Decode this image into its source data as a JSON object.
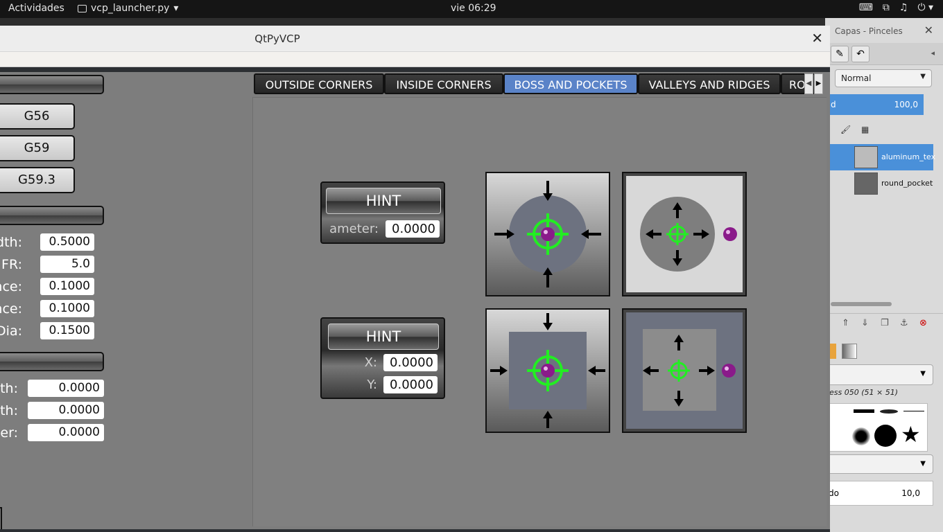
{
  "topbar": {
    "activities": "Actividades",
    "app_name": "vcp_launcher.py",
    "clock": "vie 06:29"
  },
  "gimp": {
    "dock_title": "Capas - Pinceles",
    "mode": "Normal",
    "opacity_value": "100,0",
    "layers": [
      "aluminum_tex",
      "round_pocket"
    ],
    "brush_name": "ess 050 (51 × 51)",
    "spacing_label": "do",
    "spacing_value": "10,0"
  },
  "window": {
    "title": "QtPyVCP"
  },
  "left": {
    "g_buttons": [
      "G56",
      "G59",
      "G59.3"
    ],
    "fields_a": [
      {
        "label": "dth:",
        "value": "0.5000"
      },
      {
        "label": "FR:",
        "value": "5.0"
      },
      {
        "label": "nce:",
        "value": "0.1000"
      },
      {
        "label": "nce:",
        "value": "0.1000"
      },
      {
        "label": "Dia:",
        "value": "0.1500"
      }
    ],
    "fields_b": [
      {
        "label": "th:",
        "value": "0.0000"
      },
      {
        "label": "th:",
        "value": "0.0000"
      },
      {
        "label": "er:",
        "value": "0.0000"
      }
    ]
  },
  "tabs": [
    "OUTSIDE CORNERS",
    "INSIDE CORNERS",
    "BOSS AND POCKETS",
    "VALLEYS AND RIDGES",
    "RO"
  ],
  "active_tab": "BOSS AND POCKETS",
  "hint1": {
    "button": "HINT",
    "label": "ameter:",
    "value": "0.0000"
  },
  "hint2": {
    "button": "HINT",
    "x_label": "X:",
    "x_value": "0.0000",
    "y_label": "Y:",
    "y_value": "0.0000"
  },
  "colors": {
    "active_tab": "#5a83c8",
    "crosshair": "#22ee22",
    "probe_ball": "#8a1a8a",
    "gimp_highlight": "#4a90d9"
  }
}
